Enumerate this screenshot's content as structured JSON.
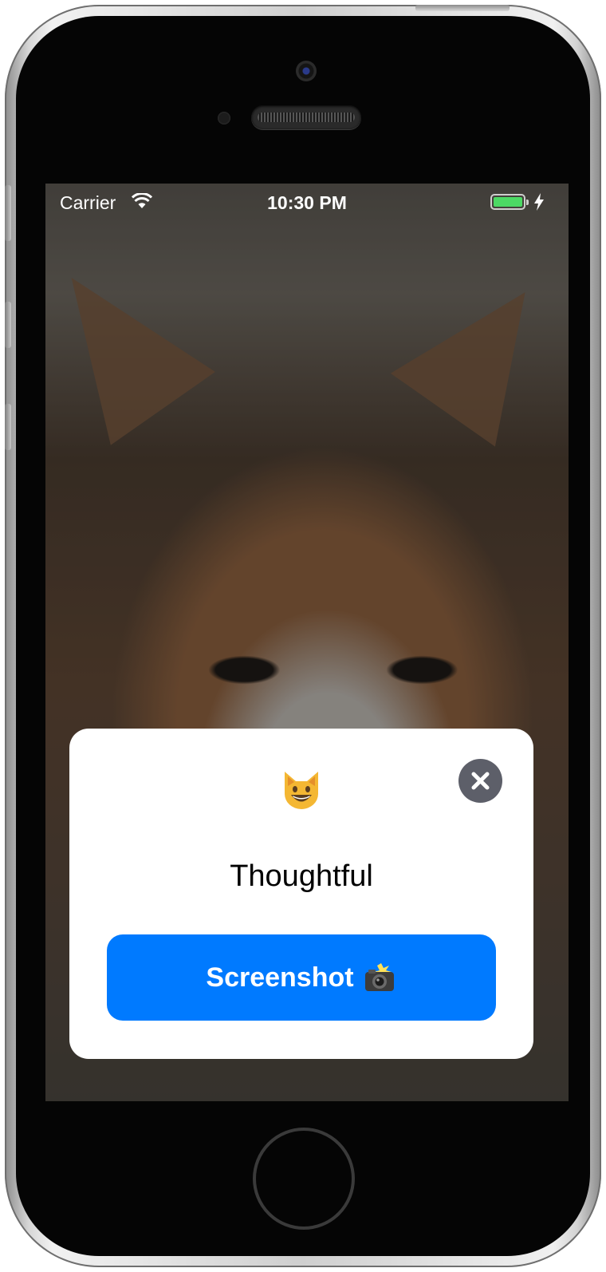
{
  "status_bar": {
    "carrier": "Carrier",
    "time": "10:30 PM",
    "battery_color": "#4cd964"
  },
  "background": {
    "content": "cat-photo"
  },
  "card": {
    "emoji_icon": "grinning-cat-face-icon",
    "title": "Thoughtful",
    "close_icon": "close-icon",
    "button_label": "Screenshot",
    "button_icon": "camera-with-flash-icon",
    "accent_color": "#007aff"
  }
}
